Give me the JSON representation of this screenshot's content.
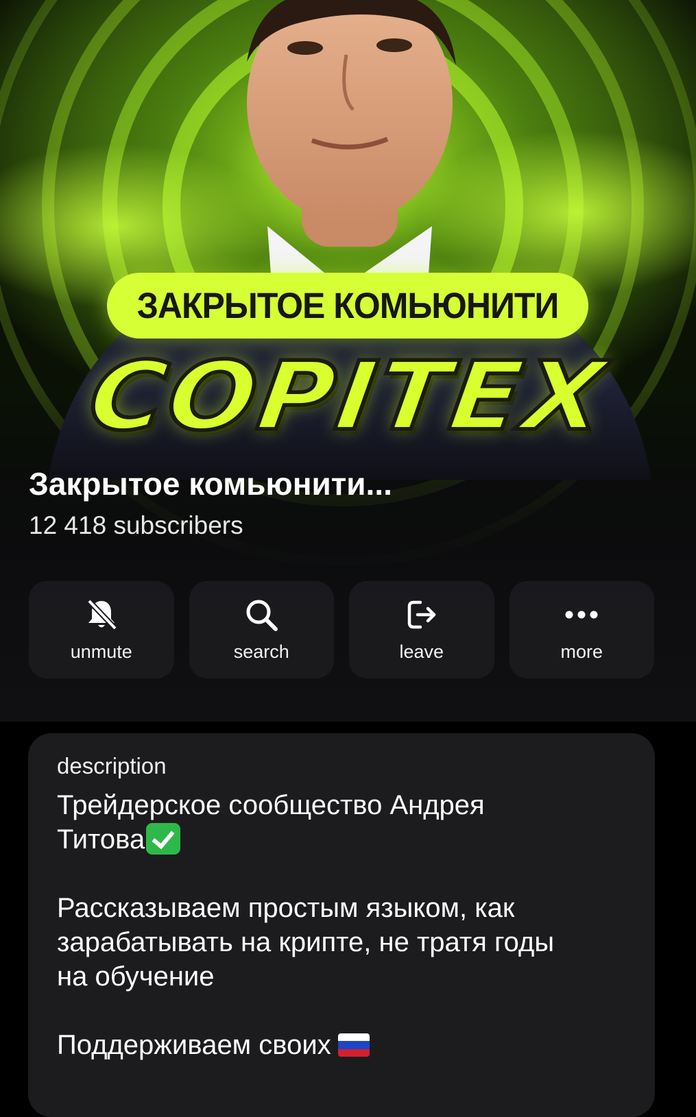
{
  "cover": {
    "pill_text": "ЗАКРЫТОЕ КОМЬЮНИТИ",
    "logo_text": "COPITEX",
    "accent_color": "#d6ff36"
  },
  "channel": {
    "title": "Закрытое комьюнити...",
    "subscribers": "12 418 subscribers"
  },
  "actions": [
    {
      "icon": "bell-slash-icon",
      "label": "unmute"
    },
    {
      "icon": "search-icon",
      "label": "search"
    },
    {
      "icon": "leave-icon",
      "label": "leave"
    },
    {
      "icon": "more-dots-icon",
      "label": "more"
    }
  ],
  "description": {
    "label": "description",
    "line1": "Трейдерское сообщество Андрея",
    "line2": "Титова",
    "line2_emoji": "check-mark-button-emoji",
    "para2_line1": "Рассказываем простым языком, как",
    "para2_line2": "зарабатывать на крипте, не тратя годы",
    "para2_line3": "на обучение",
    "para3_line1": "Поддерживаем своих",
    "para3_emoji": "russia-flag-emoji"
  }
}
